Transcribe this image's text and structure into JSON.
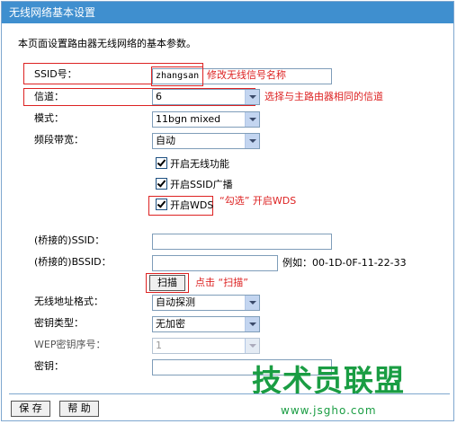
{
  "window": {
    "title": "无线网络基本设置"
  },
  "intro": "本页面设置路由器无线网络的基本参数。",
  "fields": {
    "ssid": {
      "label": "SSID号：",
      "value": "zhangsan"
    },
    "channel": {
      "label": "信道：",
      "value": "6"
    },
    "mode": {
      "label": "模式：",
      "value": "11bgn mixed"
    },
    "bandwidth": {
      "label": "频段带宽：",
      "value": "自动"
    },
    "bridge_ssid": {
      "label": "(桥接的)SSID：",
      "value": ""
    },
    "bridge_bssid": {
      "label": "(桥接的)BSSID：",
      "value": "",
      "example": "例如：00-1D-0F-11-22-33"
    },
    "addr_format": {
      "label": "无线地址格式：",
      "value": "自动探测"
    },
    "key_type": {
      "label": "密钥类型：",
      "value": "无加密"
    },
    "wep_index": {
      "label": "WEP密钥序号：",
      "value": "1"
    },
    "key": {
      "label": "密钥：",
      "value": ""
    }
  },
  "checkboxes": {
    "enable_wireless": "开启无线功能",
    "enable_ssid_broadcast": "开启SSID广播",
    "enable_wds": "开启WDS"
  },
  "buttons": {
    "scan": "扫描",
    "save": "保 存",
    "help": "帮 助"
  },
  "annotations": {
    "ssid_note": "修改无线信号名称",
    "channel_note": "选择与主路由器相同的信道",
    "wds_note": "“勾选” 开启WDS",
    "scan_note": "点击 “扫描”"
  },
  "watermark": {
    "brand": "技术员联盟",
    "url": "www.jsgho.com"
  },
  "colors": {
    "title_bar": "#3f8fcf",
    "annotation": "#dd2222",
    "watermark": "#1a9d43"
  }
}
